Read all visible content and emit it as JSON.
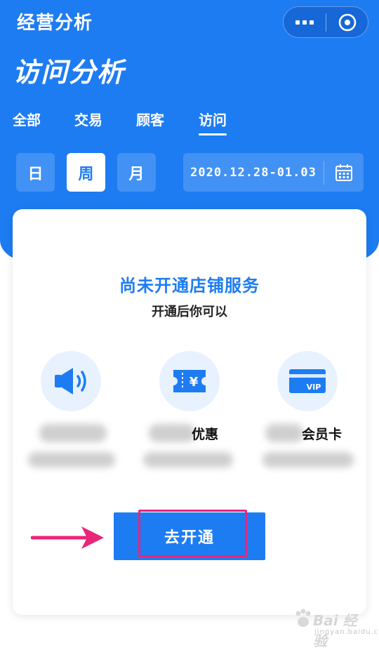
{
  "app": {
    "title": "经营分析"
  },
  "capsule": {
    "more_icon": "more-dots-icon",
    "close_icon": "close-circle-icon"
  },
  "page": {
    "title": "访问分析"
  },
  "tabs": [
    {
      "label": "全部",
      "active": false
    },
    {
      "label": "交易",
      "active": false
    },
    {
      "label": "顾客",
      "active": false
    },
    {
      "label": "访问",
      "active": true
    }
  ],
  "period": {
    "options": [
      {
        "label": "日",
        "active": false
      },
      {
        "label": "周",
        "active": true
      },
      {
        "label": "月",
        "active": false
      }
    ],
    "date_range": "2020.12.28-01.03",
    "calendar_icon": "calendar-icon"
  },
  "card": {
    "title": "尚未开通店铺服务",
    "subtitle": "开通后你可以",
    "features": [
      {
        "icon": "speaker-icon",
        "label": ""
      },
      {
        "icon": "coupon-icon",
        "label": "优惠"
      },
      {
        "icon": "vip-card-icon",
        "label": "会员卡"
      }
    ],
    "cta_label": "去开通"
  },
  "watermark": {
    "text": "Bai 经验",
    "sub": "jingyan.baidu.com"
  },
  "colors": {
    "primary": "#1e7cf2",
    "highlight": "#e8267a",
    "icon_bg": "#e7f2fe"
  }
}
